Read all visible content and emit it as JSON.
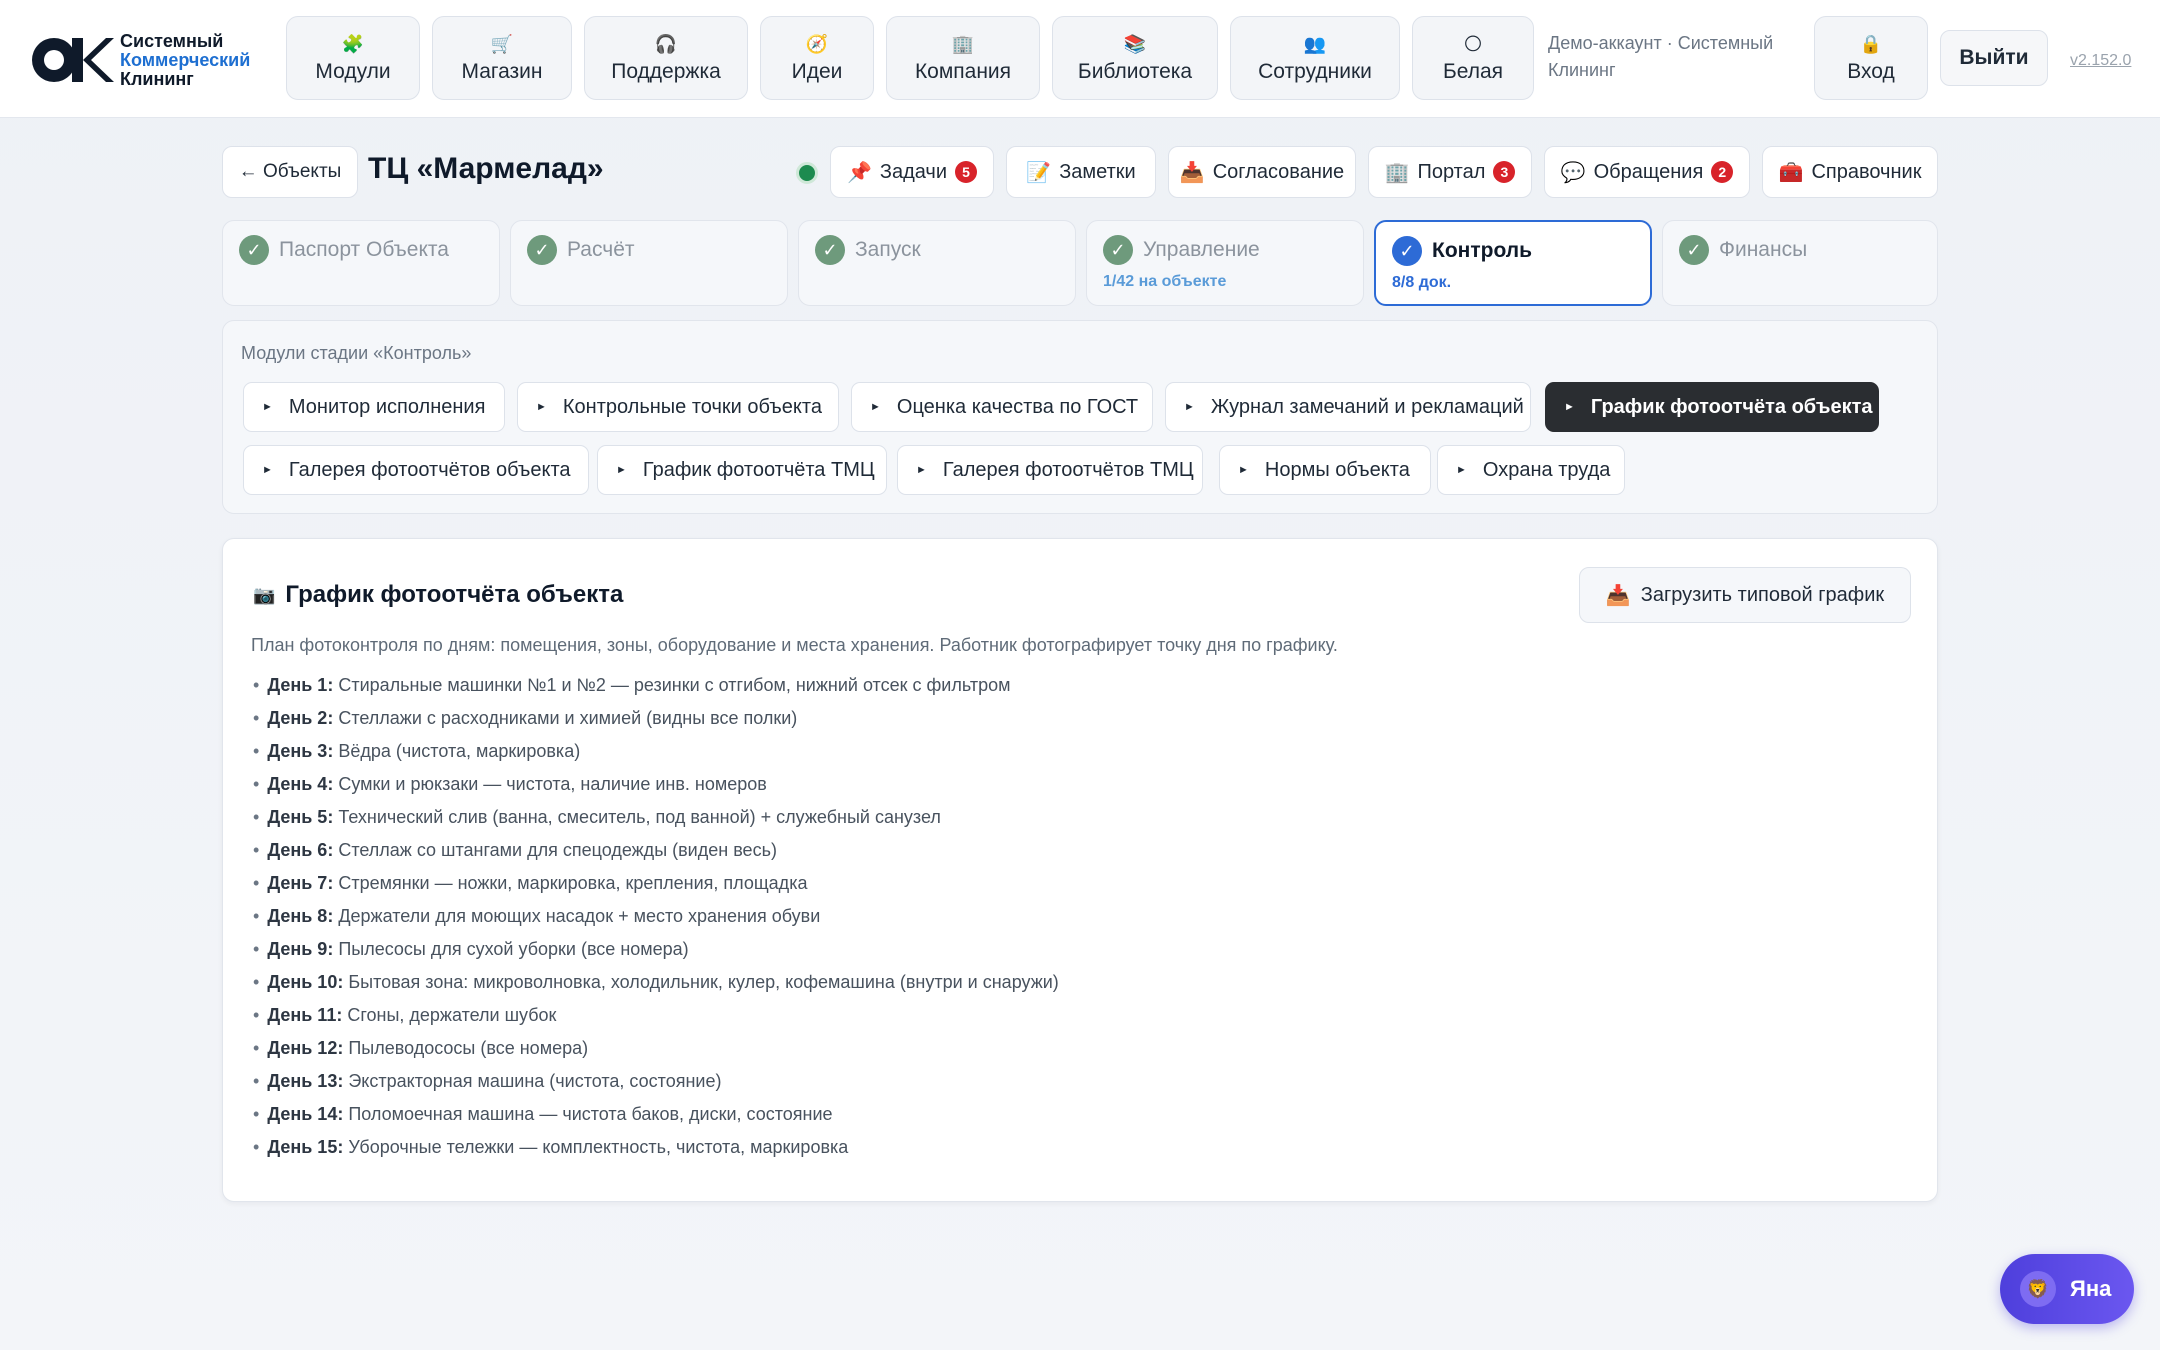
{
  "brand": {
    "line1": "Системный",
    "line2": "Коммерческий",
    "line3": "Клининг"
  },
  "nav": [
    {
      "label": "Модули",
      "icon": "🧩"
    },
    {
      "label": "Магазин",
      "icon": "🛒"
    },
    {
      "label": "Поддержка",
      "icon": "🎧"
    },
    {
      "label": "Идеи",
      "icon": "🧭"
    },
    {
      "label": "Компания",
      "icon": "🏢"
    },
    {
      "label": "Библиотека",
      "icon": "📚"
    },
    {
      "label": "Сотрудники",
      "icon": "👥"
    },
    {
      "label": "Белая",
      "icon": "🌕"
    }
  ],
  "account": {
    "text": "Демо-аккаунт · Системный Клининг",
    "login_label": "Вход",
    "login_icon": "🔒",
    "logout_label": "Выйти",
    "version": "v2.152.0"
  },
  "object": {
    "back_label": "← Объекты",
    "title": "ТЦ «Мармелад»",
    "status_color": "#1d8b4f",
    "actions": [
      {
        "label": "Задачи",
        "icon": "📌",
        "badge": "5"
      },
      {
        "label": "Заметки",
        "icon": "📝",
        "badge": ""
      },
      {
        "label": "Согласование",
        "icon": "📥",
        "badge": ""
      },
      {
        "label": "Портал",
        "icon": "🏢",
        "badge": "3"
      },
      {
        "label": "Обращения",
        "icon": "💬",
        "badge": "2"
      },
      {
        "label": "Справочник",
        "icon": "🧰",
        "badge": ""
      }
    ]
  },
  "stages": [
    {
      "label": "Паспорт Объекта",
      "sub": ""
    },
    {
      "label": "Расчёт",
      "sub": ""
    },
    {
      "label": "Запуск",
      "sub": ""
    },
    {
      "label": "Управление",
      "sub": "1/42 на объекте"
    },
    {
      "label": "Контроль",
      "sub": "8/8 док."
    },
    {
      "label": "Финансы",
      "sub": ""
    }
  ],
  "modules": {
    "caption": "Модули стадии «Контроль»",
    "items": [
      "Монитор исполнения",
      "Контрольные точки объекта",
      "Оценка качества по ГОСТ",
      "Журнал замечаний и рекламаций",
      "График фотоотчёта объекта",
      "Галерея фотоотчётов объекта",
      "График фотоотчёта ТМЦ",
      "Галерея фотоотчётов ТМЦ",
      "Нормы объекта",
      "Охрана труда"
    ],
    "active_index": 4
  },
  "schedule": {
    "title": "График фотоотчёта объекта",
    "title_icon": "📷",
    "upload_label": "Загрузить типовой график",
    "upload_icon": "📥",
    "description": "План фотоконтроля по дням: помещения, зоны, оборудование и места хранения. Работник фотографирует точку дня по графику.",
    "days": [
      {
        "day": "День 1:",
        "text": "Стиральные машинки №1 и №2 — резинки с отгибом, нижний отсек с фильтром"
      },
      {
        "day": "День 2:",
        "text": "Стеллажи с расходниками и химией (видны все полки)"
      },
      {
        "day": "День 3:",
        "text": "Вёдра (чистота, маркировка)"
      },
      {
        "day": "День 4:",
        "text": "Сумки и рюкзаки — чистота, наличие инв. номеров"
      },
      {
        "day": "День 5:",
        "text": "Технический слив (ванна, смеситель, под ванной) + служебный санузел"
      },
      {
        "day": "День 6:",
        "text": "Стеллаж со штангами для спецодежды (виден весь)"
      },
      {
        "day": "День 7:",
        "text": "Стремянки — ножки, маркировка, крепления, площадка"
      },
      {
        "day": "День 8:",
        "text": "Держатели для моющих насадок + место хранения обуви"
      },
      {
        "day": "День 9:",
        "text": "Пылесосы для сухой уборки (все номера)"
      },
      {
        "day": "День 10:",
        "text": "Бытовая зона: микроволновка, холодильник, кулер, кофемашина (внутри и снаружи)"
      },
      {
        "day": "День 11:",
        "text": "Сгоны, держатели шубок"
      },
      {
        "day": "День 12:",
        "text": "Пылеводососы (все номера)"
      },
      {
        "day": "День 13:",
        "text": "Экстракторная машина (чистота, состояние)"
      },
      {
        "day": "День 14:",
        "text": "Поломоечная машина — чистота баков, диски, состояние"
      },
      {
        "day": "День 15:",
        "text": "Уборочные тележки — комплектность, чистота, маркировка"
      }
    ]
  },
  "assistant": {
    "label": "Яна",
    "icon": "🦁"
  }
}
